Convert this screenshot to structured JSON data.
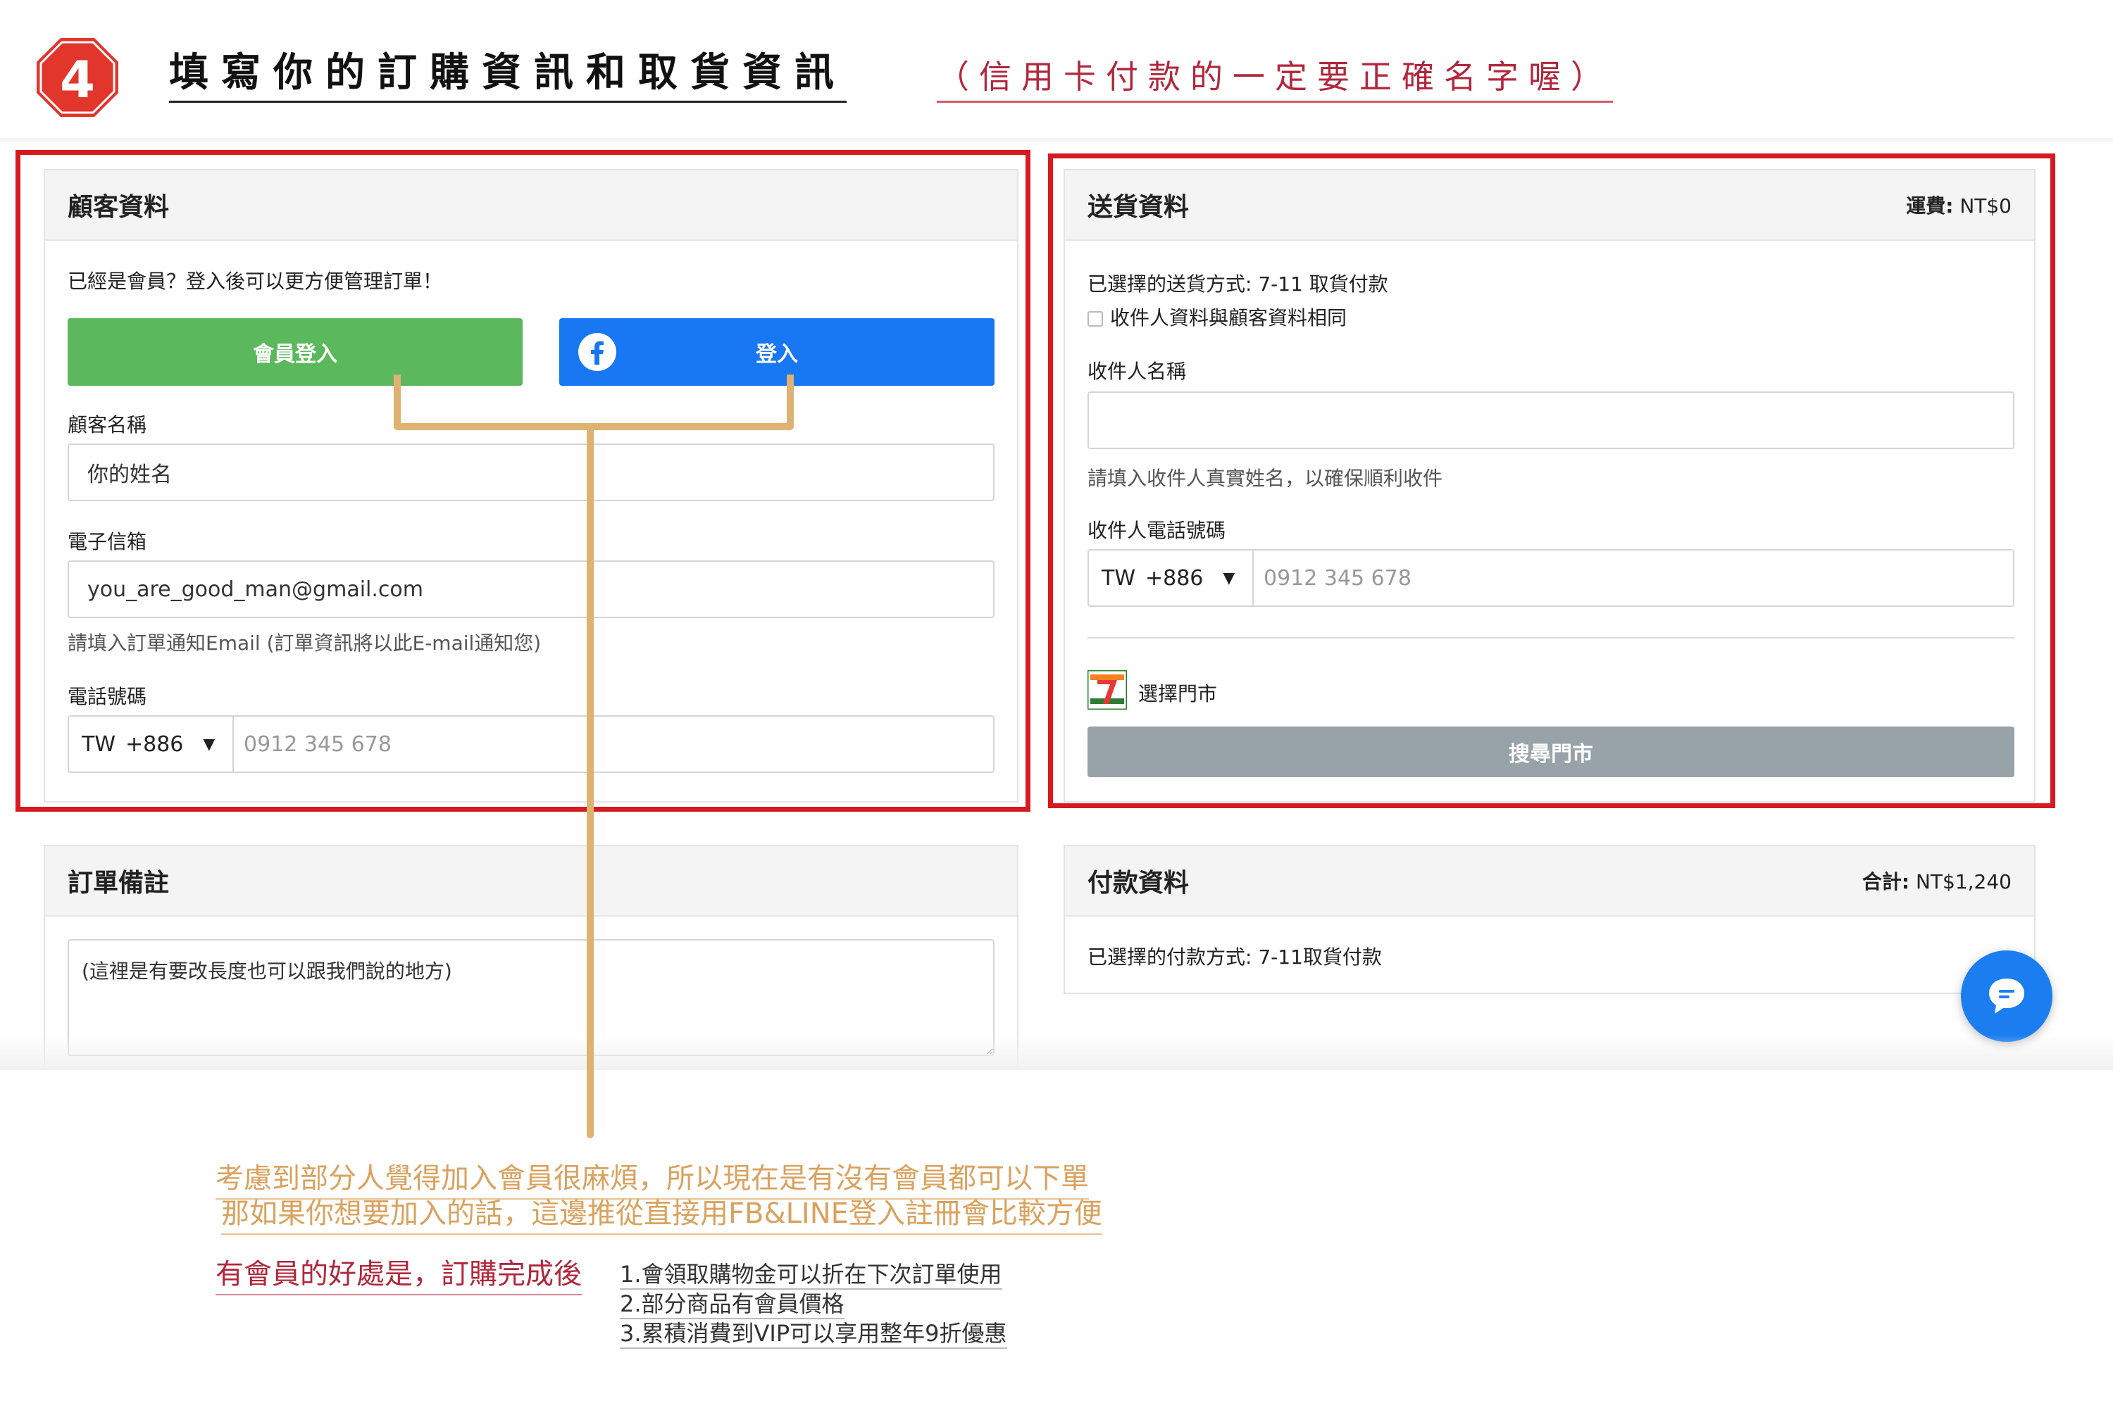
{
  "header": {
    "step_number": "4",
    "title": "填寫你的訂購資訊和取貨資訊",
    "note": "（信用卡付款的一定要正確名字喔）"
  },
  "customer": {
    "title": "顧客資料",
    "login_prompt": "已經是會員？登入後可以更方便管理訂單！",
    "member_login_button": "會員登入",
    "fb_login_button": "登入",
    "name_label": "顧客名稱",
    "name_value": "你的姓名",
    "email_label": "電子信箱",
    "email_value": "you_are_good_man@gmail.com",
    "email_hint": "請填入訂單通知Email (訂單資訊將以此E-mail通知您)",
    "phone_label": "電話號碼",
    "phone_country": "TW",
    "phone_code": "+886",
    "phone_placeholder": "0912 345 678"
  },
  "delivery": {
    "title": "送貨資料",
    "shipping_label": "運費:",
    "shipping_value": "NT$0",
    "method": "已選擇的送貨方式: 7-11 取貨付款",
    "same_as_customer": "收件人資料與顧客資料相同",
    "recipient_name_label": "收件人名稱",
    "recipient_name_value": "",
    "recipient_name_hint": "請填入收件人真實姓名，以確保順利收件",
    "recipient_phone_label": "收件人電話號碼",
    "phone_country": "TW",
    "phone_code": "+886",
    "phone_placeholder": "0912 345 678",
    "select_store_label": "選擇門市",
    "search_store_button": "搜尋門市"
  },
  "order_note": {
    "title": "訂單備註",
    "value": "(這裡是有要改長度也可以跟我們說的地方)"
  },
  "payment": {
    "title": "付款資料",
    "total_label": "合計:",
    "total_value": "NT$1,240",
    "method": "已選擇的付款方式: 7-11取貨付款"
  },
  "annotation": {
    "line1": "考慮到部分人覺得加入會員很麻煩，所以現在是有沒有會員都可以下單",
    "line2": "那如果你想要加入的話，這邊推從直接用FB&LINE登入註冊會比較方便",
    "benefit_title": "有會員的好處是，訂購完成後",
    "benefits": [
      "1.會領取購物金可以折在下次訂單使用",
      "2.部分商品有會員價格",
      "3.累積消費到VIP可以享用整年9折優惠"
    ]
  },
  "colors": {
    "red_frame": "#d71920",
    "green_button": "#5cb85c",
    "facebook_blue": "#1877f2",
    "gray_button": "#98a2a9",
    "annotation_orange": "#d9a25e",
    "annotation_red": "#b0283c"
  },
  "icons": {
    "step": "octagon-number-icon",
    "facebook": "facebook-icon",
    "store": "seven-eleven-logo",
    "chat": "chat-bubble-icon",
    "dropdown": "caret-down-icon"
  }
}
